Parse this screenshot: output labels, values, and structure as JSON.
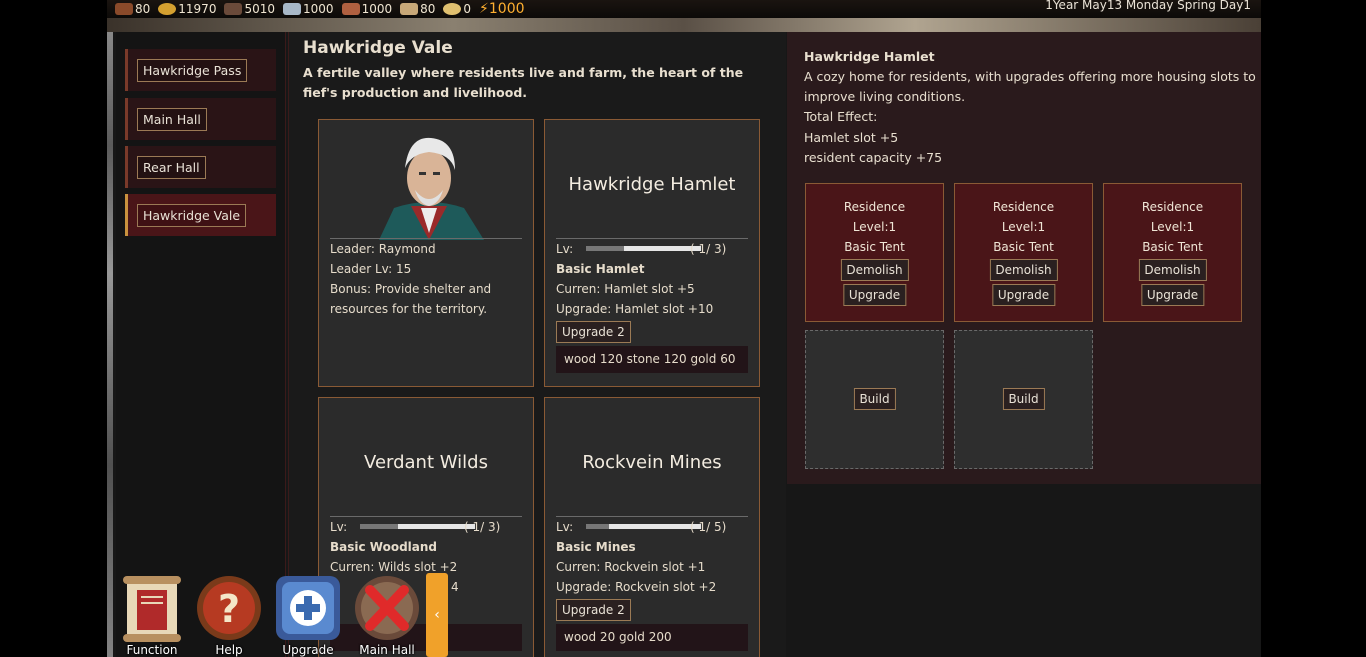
{
  "topbar": {
    "resources": [
      {
        "icon": "wood-icon",
        "value": "80"
      },
      {
        "icon": "gold-icon",
        "value": "11970"
      },
      {
        "icon": "stone-icon",
        "value": "5010"
      },
      {
        "icon": "iron-icon",
        "value": "1000"
      },
      {
        "icon": "brick-icon",
        "value": "1000"
      },
      {
        "icon": "grain-icon",
        "value": "80"
      },
      {
        "icon": "coin-icon",
        "value": "0"
      },
      {
        "icon": "energy-icon",
        "value": "1000"
      }
    ],
    "date": "1Year May13 Monday Spring Day1"
  },
  "sidebar": {
    "items": [
      {
        "label": "Hawkridge Pass"
      },
      {
        "label": "Main Hall"
      },
      {
        "label": "Rear Hall"
      },
      {
        "label": "Hawkridge Vale"
      }
    ]
  },
  "main": {
    "title": "Hawkridge Vale",
    "description": "A fertile valley where residents live and farm, the heart of the fief's production and livelihood.",
    "leader": {
      "name": "Leader: Raymond",
      "level": "Leader Lv: 15",
      "bonus_1": "Bonus: Provide shelter and",
      "bonus_2": "resources for the territory."
    },
    "cards": [
      {
        "name": "Hawkridge Hamlet",
        "lv_label": "Lv:",
        "lv_text": "( 1/ 3)",
        "level": 1,
        "max_level": 3,
        "tier": "Basic Hamlet",
        "current": "Curren: Hamlet slot +5",
        "upgrade": "Upgrade: Hamlet slot +10",
        "button": "Upgrade 2",
        "cost": "wood 120 stone 120 gold 60"
      },
      {
        "name": "Verdant Wilds",
        "lv_label": "Lv:",
        "lv_text": "( 1/ 3)",
        "level": 1,
        "max_level": 3,
        "tier": "Basic Woodland",
        "current": "Curren: Wilds slot +2",
        "upgrade_tail": "4"
      },
      {
        "name": "Rockvein Mines",
        "lv_label": "Lv:",
        "lv_text": "( 1/ 5)",
        "level": 1,
        "max_level": 5,
        "tier": "Basic Mines",
        "current": "Curren: Rockvein slot +1",
        "upgrade": "Upgrade: Rockvein slot +2",
        "button": "Upgrade 2",
        "cost": "wood 20 gold 200"
      }
    ]
  },
  "detail": {
    "title": "Hawkridge Hamlet",
    "desc_1": "A cozy home for residents, with upgrades offering more housing slots to",
    "desc_2": "improve living conditions.",
    "effect_label": "Total Effect:",
    "effect_1": "Hamlet slot +5",
    "effect_2": "resident capacity +75",
    "slots": [
      {
        "type": "Residence",
        "level": "Level:1",
        "name": "Basic Tent",
        "demolish": "Demolish",
        "upgrade": "Upgrade"
      },
      {
        "type": "Residence",
        "level": "Level:1",
        "name": "Basic Tent",
        "demolish": "Demolish",
        "upgrade": "Upgrade"
      },
      {
        "type": "Residence",
        "level": "Level:1",
        "name": "Basic Tent",
        "demolish": "Demolish",
        "upgrade": "Upgrade"
      }
    ],
    "build_label": "Build"
  },
  "toolbar": {
    "function": "Function",
    "help": "Help",
    "upgrade": "Upgrade",
    "main_hall": "Main Hall",
    "collapse": "‹"
  }
}
